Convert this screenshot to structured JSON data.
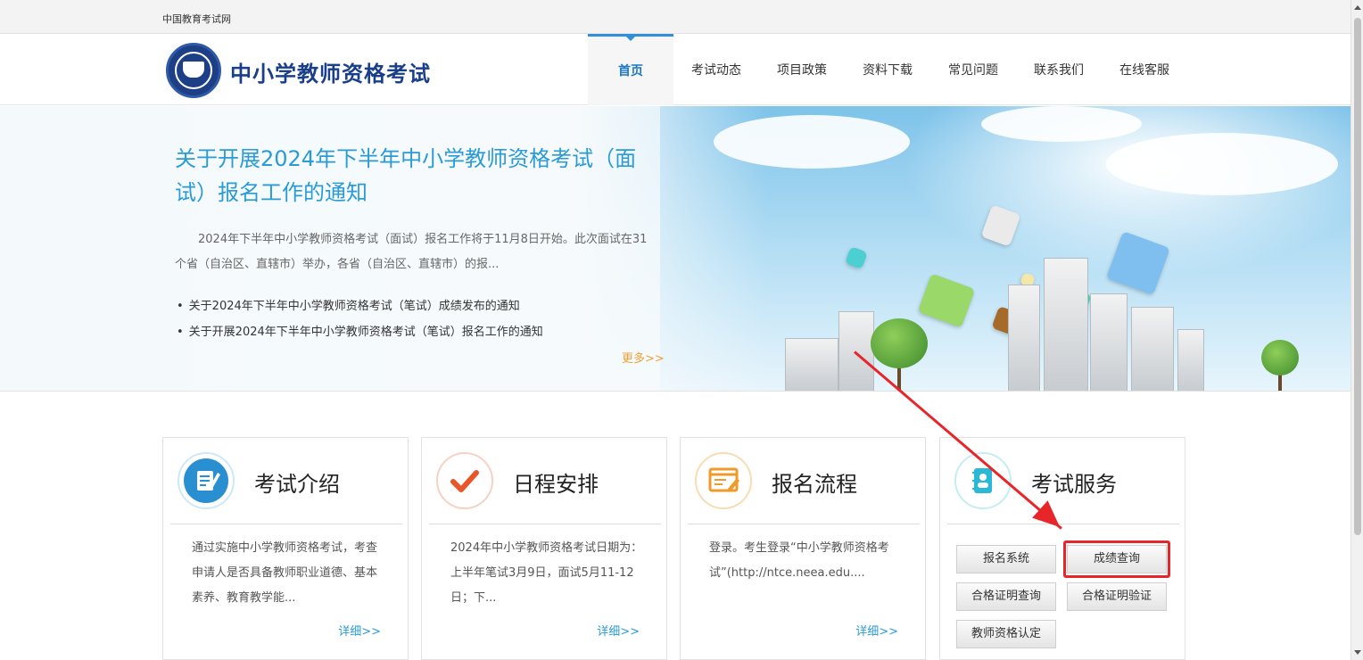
{
  "topbar": {
    "site_name": "中国教育考试网"
  },
  "header": {
    "brand": "中小学教师资格考试",
    "nav": [
      "首页",
      "考试动态",
      "项目政策",
      "资料下载",
      "常见问题",
      "联系我们",
      "在线客服"
    ]
  },
  "banner": {
    "title": "关于开展2024年下半年中小学教师资格考试（面试）报名工作的通知",
    "summary": "2024年下半年中小学教师资格考试（面试）报名工作将于11月8日开始。此次面试在31个省（自治区、直辖市）举办，各省（自治区、直辖市）的报...",
    "links": [
      "关于2024年下半年中小学教师资格考试（笔试）成绩发布的通知",
      "关于开展2024年下半年中小学教师资格考试（笔试）报名工作的通知"
    ],
    "more": "更多>>"
  },
  "cards": [
    {
      "title": "考试介绍",
      "text": "通过实施中小学教师资格考试，考查申请人是否具备教师职业道德、基本素养、教育教学能...",
      "detail": "详细>>"
    },
    {
      "title": "日程安排",
      "text": "2024年中小学教师资格考试日期为：上半年笔试3月9日，面试5月11-12日；下...",
      "detail": "详细>>"
    },
    {
      "title": "报名流程",
      "text": "登录。考生登录“中小学教师资格考试”(http://ntce.neea.edu....",
      "detail": "详细>>"
    },
    {
      "title": "考试服务"
    }
  ],
  "services": [
    "报名系统",
    "成绩查询",
    "合格证明查询",
    "合格证明验证",
    "教师资格认定"
  ],
  "colors": {
    "accent": "#2a9bd6",
    "brand": "#1a3f8a",
    "highlight": "#e8262a"
  }
}
